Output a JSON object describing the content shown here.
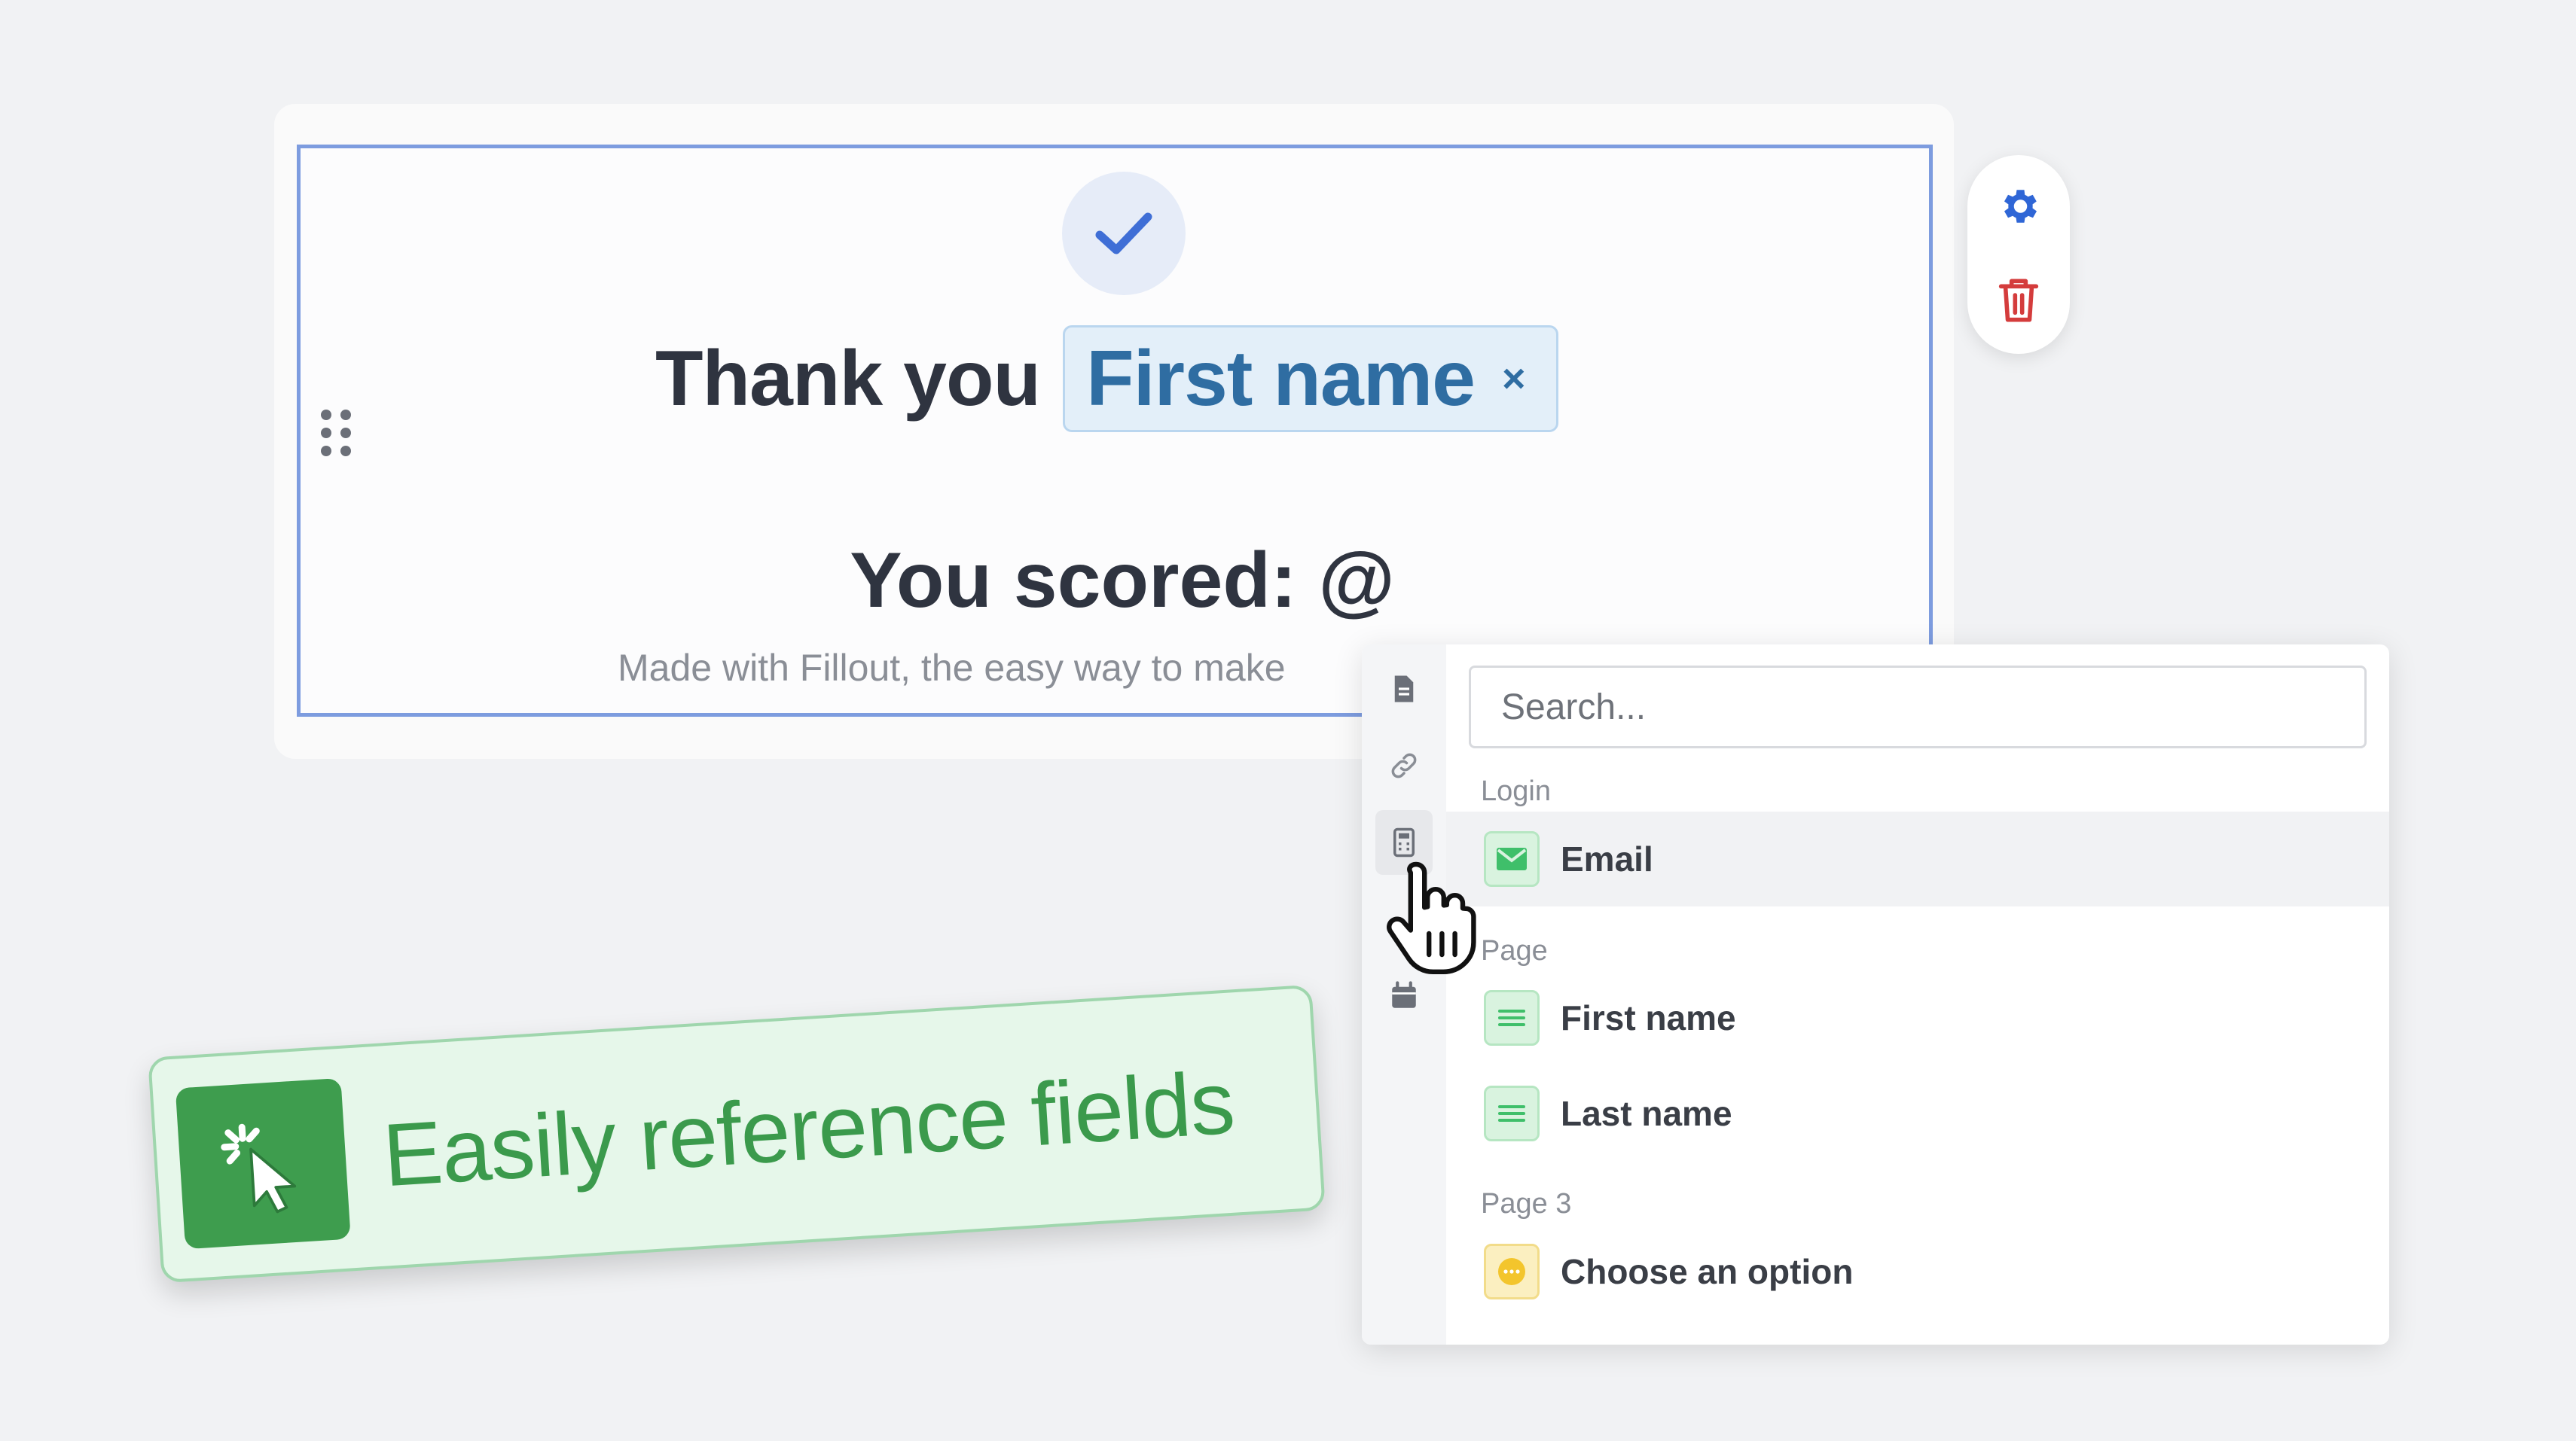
{
  "form": {
    "headline_prefix": "Thank you",
    "reference_chip": {
      "label": "First name",
      "close_glyph": "×"
    },
    "score_text": "You scored: @",
    "branding_text": "Made with Fillout, the easy way to make"
  },
  "actions": {
    "settings_icon": "gear-icon",
    "delete_icon": "trash-icon",
    "settings_color": "#2f66d6",
    "delete_color": "#d43c3c"
  },
  "reference_picker": {
    "search_placeholder": "Search...",
    "rail_icons": [
      "document-icon",
      "link-icon",
      "calculator-icon",
      "calendar-icon"
    ],
    "active_rail_index": 2,
    "groups": [
      {
        "label": "Login",
        "fields": [
          {
            "label": "Email",
            "icon": "envelope-icon",
            "hovered": true
          }
        ]
      },
      {
        "label": "Page",
        "fields": [
          {
            "label": "First name",
            "icon": "short-text-icon"
          },
          {
            "label": "Last name",
            "icon": "short-text-icon"
          }
        ]
      },
      {
        "label": "Page 3",
        "fields": [
          {
            "label": "Choose an option",
            "icon": "dropdown-choice-icon"
          }
        ]
      }
    ]
  },
  "banner": {
    "text": "Easily reference fields",
    "icon": "click-cursor-icon",
    "accent": "#3e9d4e"
  }
}
